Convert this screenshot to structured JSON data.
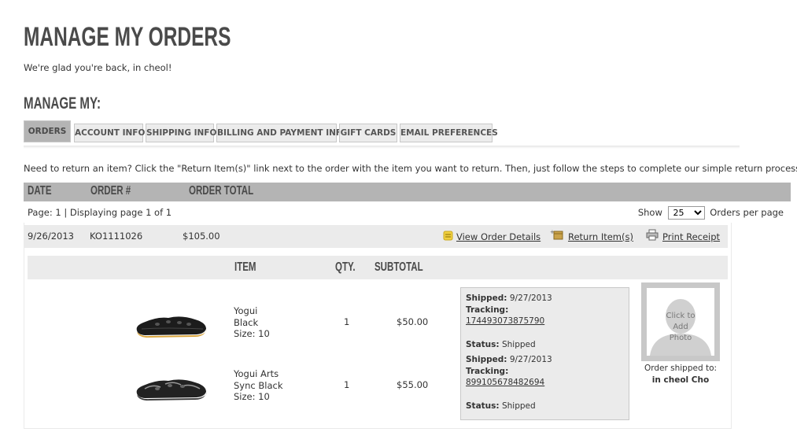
{
  "page": {
    "title": "MANAGE MY ORDERS",
    "welcome": "We're glad you're back, in cheol!",
    "manage_heading": "MANAGE MY:"
  },
  "tabs": [
    {
      "label": "ORDERS",
      "active": true
    },
    {
      "label": "ACCOUNT INFO",
      "active": false
    },
    {
      "label": "SHIPPING INFO",
      "active": false
    },
    {
      "label": "BILLING AND PAYMENT INFO",
      "active": false
    },
    {
      "label": "GIFT CARDS",
      "active": false
    },
    {
      "label": "EMAIL PREFERENCES",
      "active": false
    }
  ],
  "return_note": "Need to return an item? Click the \"Return Item(s)\" link next to the order with the item you want to return. Then, just follow the steps to complete our simple return process.",
  "table_header": {
    "date": "DATE",
    "order_num": "ORDER #",
    "order_total": "ORDER TOTAL"
  },
  "pagination": {
    "page_info": "Page: 1  | Displaying page 1 of 1",
    "show_label": "Show",
    "per_page_value": "25",
    "per_page_label": "Orders per page"
  },
  "order": {
    "date": "9/26/2013",
    "number": "KO1111026",
    "total": "$105.00",
    "view_details": "View Order Details",
    "return_items": "Return Item(s)",
    "print_receipt": "Print Receipt"
  },
  "items_header": {
    "item": "ITEM",
    "qty": "QTY.",
    "subtotal": "SUBTOTAL"
  },
  "items": [
    {
      "name1": "Yogui",
      "name2": "Black",
      "size": "Size: 10",
      "qty": "1",
      "subtotal": "$50.00",
      "shipped_label": "Shipped:",
      "shipped_date": "9/27/2013",
      "tracking_label": "Tracking:",
      "tracking_number": "174493073875790",
      "status_label": "Status:",
      "status": "Shipped"
    },
    {
      "name1": "Yogui Arts",
      "name2": "Sync Black",
      "size": "Size: 10",
      "qty": "1",
      "subtotal": "$55.00",
      "shipped_label": "Shipped:",
      "shipped_date": "9/27/2013",
      "tracking_label": "Tracking:",
      "tracking_number": "899105678482694",
      "status_label": "Status:",
      "status": "Shipped"
    }
  ],
  "photo": {
    "line1": "Click to",
    "line2": "Add",
    "line3": "Photo"
  },
  "shipped_to": {
    "label": "Order shipped to:",
    "name": "in cheol Cho"
  },
  "colors": {
    "header_gray": "#b4b4b4",
    "row_gray": "#ebebeb",
    "title_gray": "#4a4a4a",
    "icon_yellow": "#e6c83c"
  },
  "icons": {
    "view_details": "note-icon",
    "return_items": "box-return-icon",
    "print_receipt": "printer-icon"
  }
}
